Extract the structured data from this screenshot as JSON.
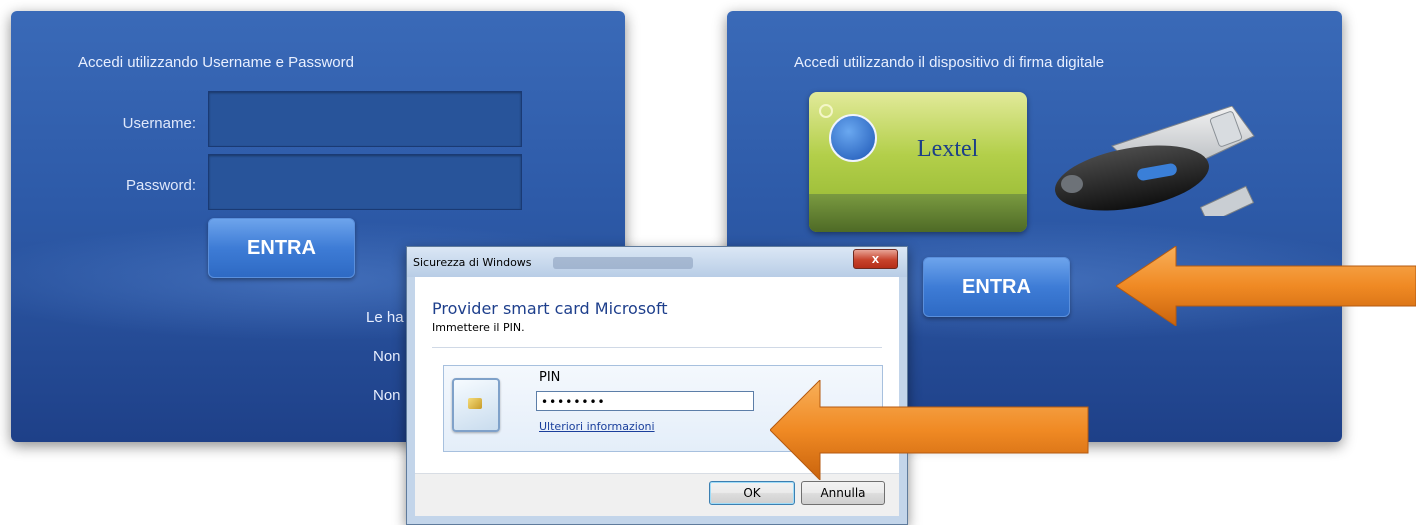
{
  "login_password": {
    "title": "Accedi utilizzando Username e Password",
    "username_label": "Username:",
    "password_label": "Password:",
    "username_value": "",
    "password_value": "",
    "submit_label": "ENTRA",
    "help_lines": [
      "Le ha",
      "Non",
      "Non"
    ]
  },
  "login_digital_signature": {
    "title": "Accedi utilizzando il dispositivo di firma digitale",
    "card_brand": "Lextel",
    "submit_label": "ENTRA"
  },
  "dialog": {
    "window_title": "Sicurezza di Windows",
    "close_symbol": "x",
    "heading": "Provider smart card Microsoft",
    "instruction": "Immettere il PIN.",
    "pin_label": "PIN",
    "pin_value": "••••••••",
    "more_info_link": "Ulteriori informazioni",
    "ok_label": "OK",
    "cancel_label": "Annulla"
  },
  "colors": {
    "panel_blue": "#2d5aa8",
    "button_blue": "#3e7cd6",
    "arrow_orange": "#f08a24",
    "dialog_heading_blue": "#1e3f8c"
  },
  "icons": [
    "smart-card-icon",
    "usb-token-icon",
    "close-icon",
    "arrow-icon"
  ]
}
